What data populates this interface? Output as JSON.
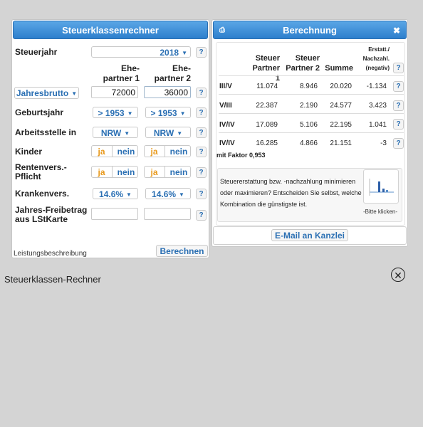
{
  "left": {
    "title": "Steuerklassenrechner",
    "steuerjahr_label": "Steuerjahr",
    "steuerjahr_value": "2018",
    "partner1_l1": "Ehe-",
    "partner1_l2": "partner 1",
    "partner2_l1": "Ehe-",
    "partner2_l2": "partner 2",
    "income_type": "Jahresbrutto",
    "income_p1": "72000",
    "income_p2": "36000",
    "geburtsjahr_label": "Geburtsjahr",
    "geburtsjahr_p1": "> 1953",
    "geburtsjahr_p2": "> 1953",
    "arbeitsstelle_label": "Arbeitsstelle in",
    "arbeitsstelle_p1": "NRW",
    "arbeitsstelle_p2": "NRW",
    "kinder_label": "Kinder",
    "renten_l1": "Rentenvers.-",
    "renten_l2": "Pflicht",
    "kranken_label": "Krankenvers.",
    "kranken_p1": "14.6%",
    "kranken_p2": "14.6%",
    "freibetrag_l1": "Jahres-Freibetrag",
    "freibetrag_l2": "aus LStKarte",
    "ja": "ja",
    "nein": "nein",
    "help": "?",
    "leistung": "Leistungsbeschreibung",
    "berechnen": "Berechnen"
  },
  "right": {
    "title": "Berechnung",
    "close": "✖",
    "col_steuer1_l1": "Steuer",
    "col_steuer1_l2": "Partner 1",
    "col_steuer2_l1": "Steuer",
    "col_steuer2_l2": "Partner 2",
    "col_summe": "Summe",
    "col_erstatt_l1": "Erstatt./",
    "col_erstatt_l2": "Nachzahl.",
    "col_erstatt_l3": "(negativ)",
    "rows": [
      {
        "klasse": "III/V",
        "p1": "11.074",
        "p2": "8.946",
        "sum": "20.020",
        "diff": "-1.134"
      },
      {
        "klasse": "V/III",
        "p1": "22.387",
        "p2": "2.190",
        "sum": "24.577",
        "diff": "3.423"
      },
      {
        "klasse": "IV/IV",
        "p1": "17.089",
        "p2": "5.106",
        "sum": "22.195",
        "diff": "1.041"
      },
      {
        "klasse": "IV/IV",
        "p1": "16.285",
        "p2": "4.866",
        "sum": "21.151",
        "diff": "-3"
      }
    ],
    "faktor": "mit Faktor 0,953",
    "info_text": "Steuererstattung bzw. -nachzahlung minimieren oder maximieren? Entscheiden Sie selbst, welche Kombination die günstigste ist.",
    "bitte": "-Bitte klicken-",
    "email": "E-Mail an Kanzlei"
  },
  "caption": "Steuerklassen-Rechner",
  "colors": {
    "accent": "#2d7fcc",
    "orange": "#e89a1e",
    "panel_bg": "#ffffff"
  }
}
